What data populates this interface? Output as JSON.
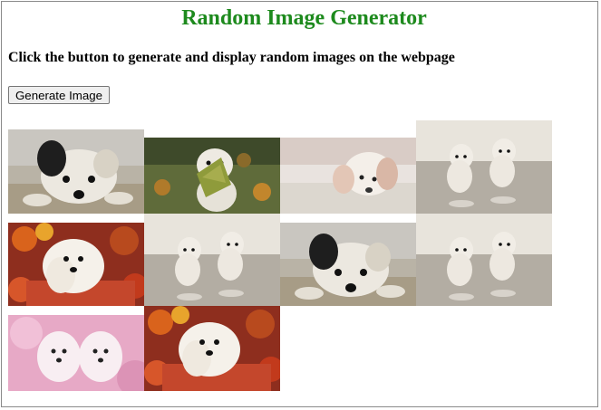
{
  "page": {
    "title": "Random Image Generator",
    "subtitle": "Click the button to generate and display random images on the webpage",
    "button_label": "Generate Image",
    "title_color": "#1d8a1d"
  },
  "images": [
    {
      "subject": "black-white-puppy-lying"
    },
    {
      "subject": "puppy-with-leaf"
    },
    {
      "subject": "puppy-on-blanket"
    },
    {
      "subject": "two-running-puppies"
    },
    {
      "subject": "puppy-in-autumn-leaves"
    },
    {
      "subject": "two-running-puppies"
    },
    {
      "subject": "black-white-puppy-lying"
    },
    {
      "subject": "two-running-puppies"
    },
    {
      "subject": "two-puppies-pink"
    },
    {
      "subject": "puppy-in-autumn-leaves"
    }
  ]
}
